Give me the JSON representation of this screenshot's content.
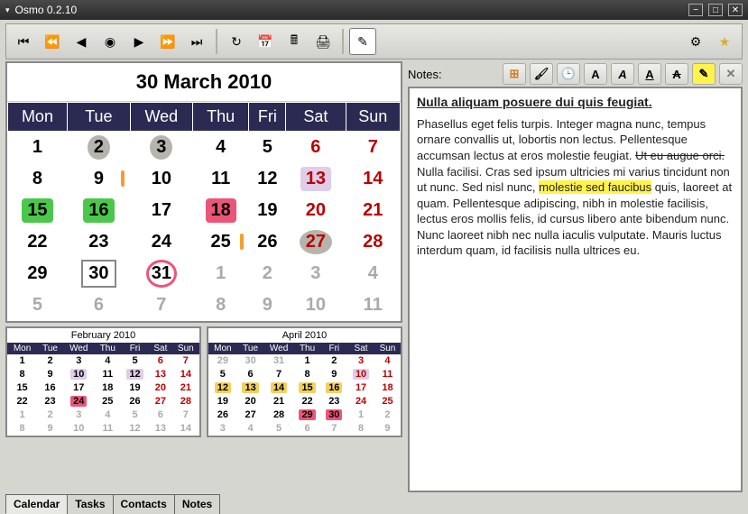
{
  "window": {
    "title": "Osmo 0.2.10"
  },
  "toolbar": {
    "nav_first": "⏮",
    "nav_prev2": "⏪",
    "nav_prev": "◀",
    "nav_today": "◉",
    "nav_next": "▶",
    "nav_next2": "⏩",
    "nav_last": "⏭",
    "refresh": "↻",
    "calendar": "📅",
    "calculator": "🖩",
    "print": "🖨",
    "edit": "✎",
    "prefs": "⚙",
    "star": "★"
  },
  "calendar": {
    "title": "30 March 2010",
    "dow": [
      "Mon",
      "Tue",
      "Wed",
      "Thu",
      "Fri",
      "Sat",
      "Sun"
    ],
    "rows": [
      [
        {
          "v": "1"
        },
        {
          "v": "2",
          "bg": "gray"
        },
        {
          "v": "3",
          "bg": "gray"
        },
        {
          "v": "4"
        },
        {
          "v": "5"
        },
        {
          "v": "6",
          "cls": "weekend"
        },
        {
          "v": "7",
          "cls": "weekend"
        }
      ],
      [
        {
          "v": "8"
        },
        {
          "v": "9",
          "ob": true
        },
        {
          "v": "10",
          "deg": true
        },
        {
          "v": "11",
          "deg": true
        },
        {
          "v": "12",
          "deg": true
        },
        {
          "v": "13",
          "deg": true,
          "bg": "lavender",
          "cls": "weekend"
        },
        {
          "v": "14",
          "cls": "weekend"
        }
      ],
      [
        {
          "v": "15",
          "deg": true,
          "bg": "green"
        },
        {
          "v": "16",
          "deg": true,
          "bg": "green"
        },
        {
          "v": "17"
        },
        {
          "v": "18",
          "deg": true,
          "bg": "pink"
        },
        {
          "v": "19"
        },
        {
          "v": "20",
          "cls": "weekend"
        },
        {
          "v": "21",
          "cls": "weekend"
        }
      ],
      [
        {
          "v": "22"
        },
        {
          "v": "23"
        },
        {
          "v": "24"
        },
        {
          "v": "25",
          "ob": true
        },
        {
          "v": "26"
        },
        {
          "v": "27",
          "bg": "gray",
          "cls": "weekend"
        },
        {
          "v": "28",
          "cls": "weekend"
        }
      ],
      [
        {
          "v": "29"
        },
        {
          "v": "30",
          "deg": true,
          "today": true
        },
        {
          "v": "31",
          "circ": true
        },
        {
          "v": "1",
          "cls": "dim"
        },
        {
          "v": "2",
          "cls": "dim"
        },
        {
          "v": "3",
          "cls": "dim"
        },
        {
          "v": "4",
          "cls": "dim"
        }
      ],
      [
        {
          "v": "5",
          "cls": "dim"
        },
        {
          "v": "6",
          "cls": "dim"
        },
        {
          "v": "7",
          "cls": "dim"
        },
        {
          "v": "8",
          "cls": "dim"
        },
        {
          "v": "9",
          "cls": "dim"
        },
        {
          "v": "10",
          "cls": "dim"
        },
        {
          "v": "11",
          "cls": "dim"
        }
      ]
    ]
  },
  "mini_prev": {
    "title": "February 2010",
    "dow": [
      "Mon",
      "Tue",
      "Wed",
      "Thu",
      "Fri",
      "Sat",
      "Sun"
    ],
    "rows": [
      [
        {
          "v": "1"
        },
        {
          "v": "2"
        },
        {
          "v": "3"
        },
        {
          "v": "4"
        },
        {
          "v": "5"
        },
        {
          "v": "6",
          "cls": "weekend"
        },
        {
          "v": "7",
          "cls": "weekend"
        }
      ],
      [
        {
          "v": "8"
        },
        {
          "v": "9"
        },
        {
          "v": "10",
          "deg": true,
          "bg": "lavender"
        },
        {
          "v": "11"
        },
        {
          "v": "12",
          "deg": true,
          "bg": "lavender"
        },
        {
          "v": "13",
          "cls": "weekend"
        },
        {
          "v": "14",
          "cls": "weekend"
        }
      ],
      [
        {
          "v": "15"
        },
        {
          "v": "16"
        },
        {
          "v": "17"
        },
        {
          "v": "18"
        },
        {
          "v": "19"
        },
        {
          "v": "20",
          "cls": "weekend"
        },
        {
          "v": "21",
          "cls": "weekend"
        }
      ],
      [
        {
          "v": "22"
        },
        {
          "v": "23"
        },
        {
          "v": "24",
          "deg": true,
          "bg": "pink"
        },
        {
          "v": "25"
        },
        {
          "v": "26"
        },
        {
          "v": "27",
          "cls": "weekend"
        },
        {
          "v": "28",
          "cls": "weekend"
        }
      ],
      [
        {
          "v": "1",
          "cls": "dim"
        },
        {
          "v": "2",
          "cls": "dim"
        },
        {
          "v": "3",
          "cls": "dim"
        },
        {
          "v": "4",
          "cls": "dim"
        },
        {
          "v": "5",
          "cls": "dim"
        },
        {
          "v": "6",
          "cls": "dim"
        },
        {
          "v": "7",
          "cls": "dim"
        }
      ],
      [
        {
          "v": "8",
          "cls": "dim"
        },
        {
          "v": "9",
          "cls": "dim"
        },
        {
          "v": "10",
          "cls": "dim"
        },
        {
          "v": "11",
          "cls": "dim"
        },
        {
          "v": "12",
          "cls": "dim"
        },
        {
          "v": "13",
          "cls": "dim"
        },
        {
          "v": "14",
          "cls": "dim"
        }
      ]
    ]
  },
  "mini_next": {
    "title": "April 2010",
    "dow": [
      "Mon",
      "Tue",
      "Wed",
      "Thu",
      "Fri",
      "Sat",
      "Sun"
    ],
    "rows": [
      [
        {
          "v": "29",
          "cls": "dim"
        },
        {
          "v": "30",
          "cls": "dim"
        },
        {
          "v": "31",
          "cls": "dim"
        },
        {
          "v": "1"
        },
        {
          "v": "2"
        },
        {
          "v": "3",
          "cls": "weekend"
        },
        {
          "v": "4",
          "cls": "weekend"
        }
      ],
      [
        {
          "v": "5"
        },
        {
          "v": "6"
        },
        {
          "v": "7"
        },
        {
          "v": "8"
        },
        {
          "v": "9"
        },
        {
          "v": "10",
          "deg": true,
          "bg": "lavender",
          "cls": "weekend"
        },
        {
          "v": "11",
          "cls": "weekend"
        }
      ],
      [
        {
          "v": "12",
          "deg": true,
          "bg": "yellow"
        },
        {
          "v": "13",
          "deg": true,
          "bg": "yellow"
        },
        {
          "v": "14",
          "deg": true,
          "bg": "yellow"
        },
        {
          "v": "15",
          "deg": true,
          "bg": "yellow"
        },
        {
          "v": "16",
          "deg": true,
          "bg": "yellow"
        },
        {
          "v": "17",
          "cls": "weekend"
        },
        {
          "v": "18",
          "cls": "weekend"
        }
      ],
      [
        {
          "v": "19"
        },
        {
          "v": "20"
        },
        {
          "v": "21"
        },
        {
          "v": "22"
        },
        {
          "v": "23"
        },
        {
          "v": "24",
          "cls": "weekend"
        },
        {
          "v": "25",
          "cls": "weekend"
        }
      ],
      [
        {
          "v": "26"
        },
        {
          "v": "27"
        },
        {
          "v": "28"
        },
        {
          "v": "29",
          "deg": true,
          "bg": "pink"
        },
        {
          "v": "30",
          "deg": true,
          "bg": "pink"
        },
        {
          "v": "1",
          "cls": "dim"
        },
        {
          "v": "2",
          "cls": "dim"
        }
      ],
      [
        {
          "v": "3",
          "cls": "dim"
        },
        {
          "v": "4",
          "cls": "dim"
        },
        {
          "v": "5",
          "cls": "dim"
        },
        {
          "v": "6",
          "cls": "dim"
        },
        {
          "v": "7",
          "cls": "dim"
        },
        {
          "v": "8",
          "cls": "dim"
        },
        {
          "v": "9",
          "cls": "dim"
        }
      ]
    ]
  },
  "notes": {
    "label": "Notes:",
    "title": "Nulla aliquam posuere dui quis feugiat.",
    "body_pre": "Phasellus eget felis turpis. Integer magna nunc, tempus ornare convallis ut, lobortis non lectus. Pellentesque accumsan lectus at eros molestie feugiat. ",
    "body_strike": "Ut eu augue orci.",
    "body_mid": " Nulla facilisi. Cras sed ipsum ultricies mi varius tincidunt non ut nunc. Sed nisl nunc, ",
    "body_highlight": "molestie sed faucibus",
    "body_post": " quis, laoreet at quam. Pellentesque adipiscing, nibh in molestie facilisis, lectus eros mollis felis, id cursus libero ante bibendum nunc. Nunc laoreet nibh nec nulla iaculis vulputate. Mauris luctus interdum quam, id facilisis nulla ultrices eu.",
    "tb": {
      "grid": "⊞",
      "brush": "🖌",
      "time": "🕒",
      "bold": "A",
      "italic": "A",
      "underline": "A",
      "strike": "A",
      "highlight": "✎",
      "close": "✕"
    }
  },
  "tabs": [
    {
      "label": "Calendar",
      "active": true
    },
    {
      "label": "Tasks"
    },
    {
      "label": "Contacts"
    },
    {
      "label": "Notes"
    }
  ]
}
